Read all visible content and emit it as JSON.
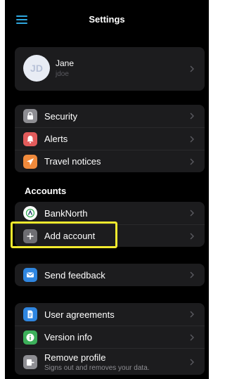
{
  "header": {
    "title": "Settings"
  },
  "profile": {
    "initials": "JD",
    "name": "Jane",
    "username": "jdoe"
  },
  "security_group": [
    {
      "label": "Security",
      "icon": "lock-icon",
      "color": "#8e8e93"
    },
    {
      "label": "Alerts",
      "icon": "alert-icon",
      "color": "#e25b5b"
    },
    {
      "label": "Travel notices",
      "icon": "airplane-icon",
      "color": "#f08a3c"
    }
  ],
  "accounts": {
    "section_title": "Accounts",
    "items": [
      {
        "label": "BankNorth",
        "icon": "bank-logo-icon",
        "color": "#ffffff"
      },
      {
        "label": "Add account",
        "icon": "plus-icon",
        "color": "#6e6e73"
      }
    ]
  },
  "feedback": {
    "label": "Send feedback",
    "icon": "mail-icon",
    "color": "#2f86e0"
  },
  "about_group": [
    {
      "label": "User agreements",
      "icon": "document-icon",
      "color": "#2f86e0"
    },
    {
      "label": "Version info",
      "icon": "info-icon",
      "color": "#3cb05a"
    },
    {
      "label": "Remove profile",
      "sublabel": "Signs out and removes your data.",
      "icon": "remove-profile-icon",
      "color": "#8e8e93"
    }
  ],
  "colors": {
    "accent": "#2fa8e0",
    "highlight": "#f2ea2e",
    "card": "#1c1c1e"
  }
}
